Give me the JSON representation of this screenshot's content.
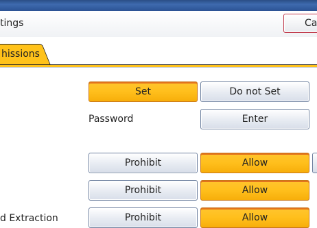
{
  "header": {
    "title": "tings",
    "cancel_label": "Car"
  },
  "tabs": [
    {
      "label": "hissions",
      "selected": true
    }
  ],
  "colors": {
    "selected_fill": "#ffc21a",
    "header_blue": "#2c5394",
    "cancel_border": "#c0394b"
  },
  "rows": {
    "set_row": {
      "set_label": "Set",
      "set_selected": true,
      "do_not_set_label": "Do not Set"
    },
    "password_row": {
      "label": "Password",
      "enter_label": "Enter"
    },
    "permission_rows": [
      {
        "label": "",
        "prohibit_label": "Prohibit",
        "allow_label": "Allow",
        "allow_selected": true
      },
      {
        "label": "",
        "prohibit_label": "Prohibit",
        "allow_label": "Allow",
        "allow_selected": true
      },
      {
        "label": "d Extraction",
        "prohibit_label": "Prohibit",
        "allow_label": "Allow",
        "allow_selected": true
      }
    ]
  }
}
